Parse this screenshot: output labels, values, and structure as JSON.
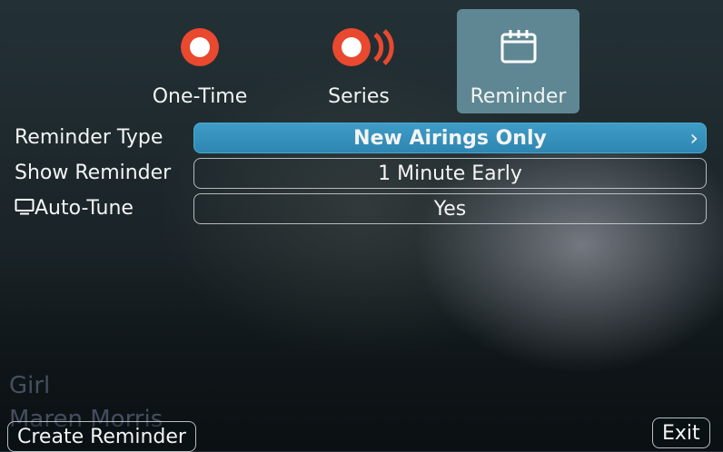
{
  "tabs": [
    {
      "label": "One-Time",
      "icon": "record-icon"
    },
    {
      "label": "Series",
      "icon": "series-record-icon"
    },
    {
      "label": "Reminder",
      "icon": "calendar-icon",
      "selected": true
    }
  ],
  "settings": {
    "reminder_type": {
      "label": "Reminder Type",
      "value": "New Airings Only"
    },
    "show_reminder": {
      "label": "Show Reminder",
      "value": "1 Minute Early"
    },
    "auto_tune": {
      "label": "Auto-Tune",
      "value": "Yes",
      "icon": "tv-icon"
    }
  },
  "background_info": {
    "title": "Girl",
    "artist": "Maren Morris"
  },
  "buttons": {
    "create": "Create Reminder",
    "exit": "Exit"
  },
  "colors": {
    "accent": "#3a97c2",
    "record": "#e8492f",
    "selected_tab": "#5e8793"
  }
}
